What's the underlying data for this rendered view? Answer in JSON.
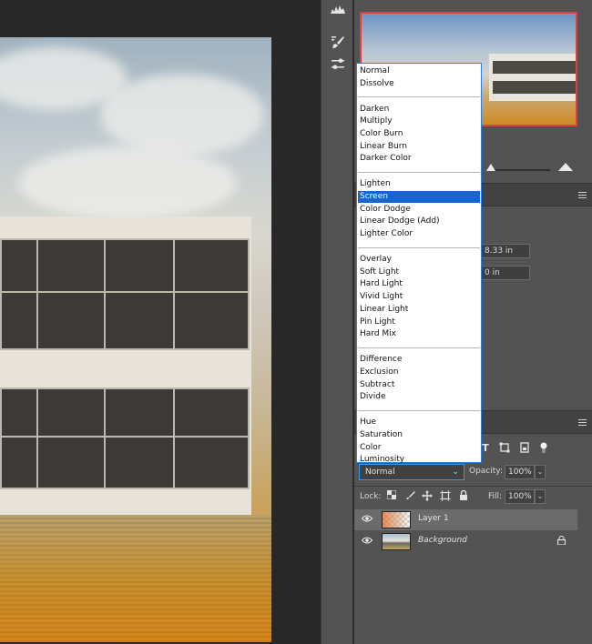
{
  "blend_menu": {
    "items": [
      {
        "label": "Normal",
        "selected": false
      },
      {
        "label": "Dissolve",
        "selected": false
      },
      {
        "label": "Darken",
        "selected": false
      },
      {
        "label": "Multiply",
        "selected": false
      },
      {
        "label": "Color Burn",
        "selected": false
      },
      {
        "label": "Linear Burn",
        "selected": false
      },
      {
        "label": "Darker Color",
        "selected": false
      },
      {
        "label": "Lighten",
        "selected": false
      },
      {
        "label": "Screen",
        "selected": true
      },
      {
        "label": "Color Dodge",
        "selected": false
      },
      {
        "label": "Linear Dodge (Add)",
        "selected": false
      },
      {
        "label": "Lighter Color",
        "selected": false
      },
      {
        "label": "Overlay",
        "selected": false
      },
      {
        "label": "Soft Light",
        "selected": false
      },
      {
        "label": "Hard Light",
        "selected": false
      },
      {
        "label": "Vivid Light",
        "selected": false
      },
      {
        "label": "Linear Light",
        "selected": false
      },
      {
        "label": "Pin Light",
        "selected": false
      },
      {
        "label": "Hard Mix",
        "selected": false
      },
      {
        "label": "Difference",
        "selected": false
      },
      {
        "label": "Exclusion",
        "selected": false
      },
      {
        "label": "Subtract",
        "selected": false
      },
      {
        "label": "Divide",
        "selected": false
      },
      {
        "label": "Hue",
        "selected": false
      },
      {
        "label": "Saturation",
        "selected": false
      },
      {
        "label": "Color",
        "selected": false
      },
      {
        "label": "Luminosity",
        "selected": false
      }
    ]
  },
  "properties": {
    "width_value": "8.33 in",
    "offset_value": "0 in"
  },
  "layers_panel": {
    "blend_mode": "Normal",
    "opacity_label": "Opacity:",
    "opacity_value": "100%",
    "lock_label": "Lock:",
    "fill_label": "Fill:",
    "fill_value": "100%",
    "layers": [
      {
        "name": "Layer 1",
        "italic": false,
        "selected": true,
        "locked": false
      },
      {
        "name": "Background",
        "italic": true,
        "selected": false,
        "locked": true
      }
    ]
  },
  "icons": {
    "histogram": "histogram-icon",
    "brush": "brush-icon",
    "adjust": "adjustments-icon"
  },
  "colors": {
    "selection_blue": "#1566d2",
    "navigator_frame": "#e04040",
    "focus_border": "#2f9bff"
  }
}
